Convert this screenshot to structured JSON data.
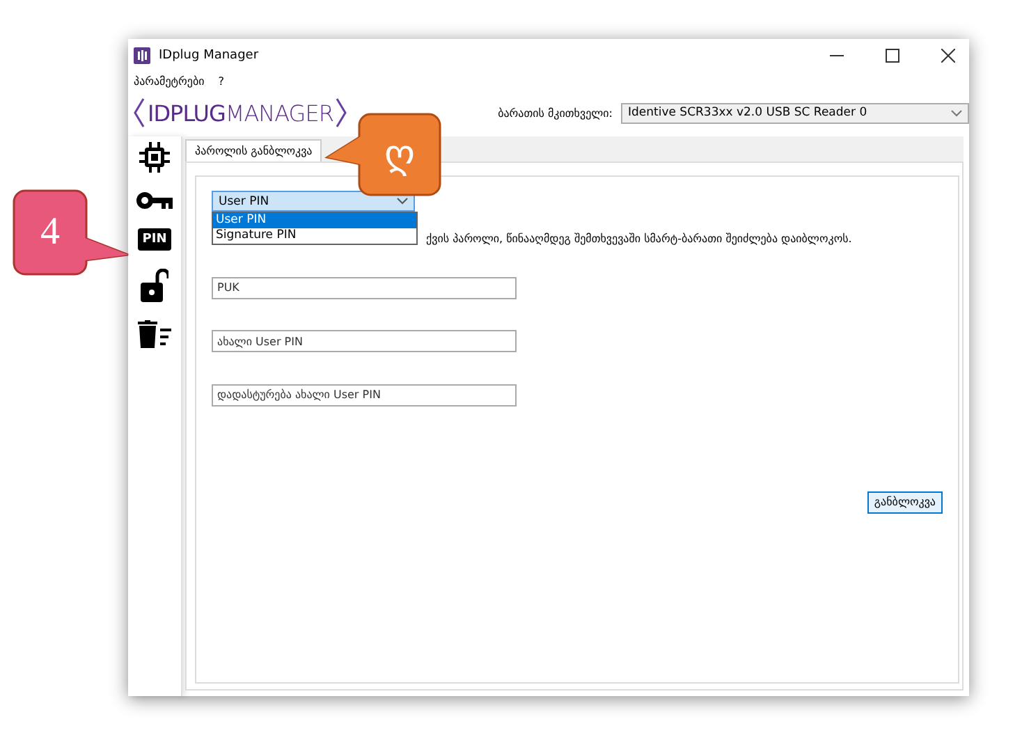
{
  "window": {
    "title": "IDplug Manager"
  },
  "menu": [
    {
      "label": "პარამეტრები"
    },
    {
      "label": "?"
    }
  ],
  "logo": {
    "bold": "IDPLUG",
    "light": "MANAGER"
  },
  "reader": {
    "label": "ბარათის მკითხველი:",
    "value": "Identive SCR33xx v2.0 USB SC Reader 0"
  },
  "sidebar": [
    {
      "kind": "chip"
    },
    {
      "kind": "key"
    },
    {
      "kind": "pin",
      "label": "PIN"
    },
    {
      "kind": "unlock"
    },
    {
      "kind": "delete"
    }
  ],
  "tabs": [
    {
      "label": "პაროლის განბლოკვა",
      "selected": true
    }
  ],
  "pin_type": {
    "value": "User PIN",
    "expanded": true,
    "options": [
      {
        "label": "User PIN",
        "selected": true
      },
      {
        "label": "Signature PIN",
        "selected": false
      }
    ]
  },
  "warning": "ქვის პაროლი, წინააღმდეგ შემთხვევაში სმარტ-ბარათი შეიძლება დაიბლოკოს.",
  "fields": [
    {
      "placeholder": "PUK"
    },
    {
      "placeholder": "ახალი User PIN"
    },
    {
      "placeholder": "დადასტურება ახალი User PIN"
    }
  ],
  "button": "განბლოკვა",
  "callouts": [
    {
      "label": "4",
      "color": "#e8587a"
    },
    {
      "label": "ღ",
      "color": "#ed7d31"
    }
  ]
}
